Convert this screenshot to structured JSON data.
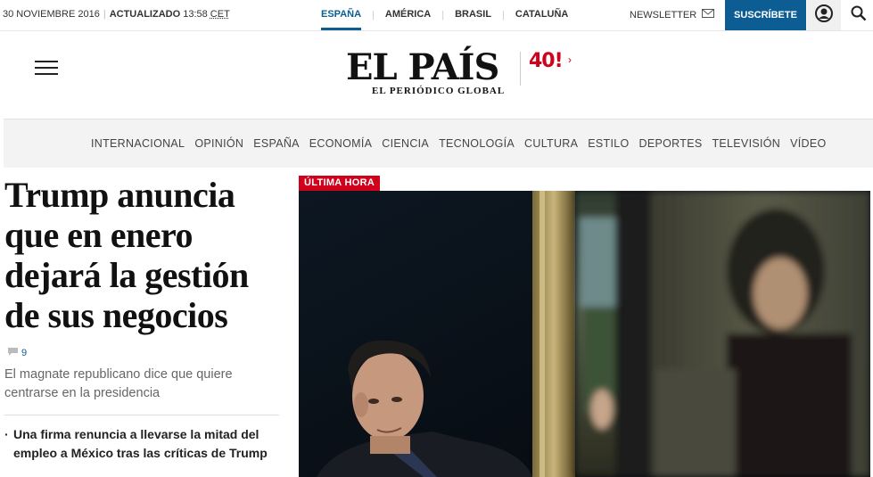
{
  "topbar": {
    "date": "30 NOVIEMBRE 2016",
    "updated_label": "ACTUALIZADO",
    "updated_time": "13:58",
    "timezone": "CET",
    "editions": [
      {
        "label": "ESPAÑA",
        "active": true
      },
      {
        "label": "AMÉRICA",
        "active": false
      },
      {
        "label": "BRASIL",
        "active": false
      },
      {
        "label": "CATALUÑA",
        "active": false
      }
    ],
    "newsletter_label": "NEWSLETTER",
    "subscribe_label": "SUSCRÍBETE"
  },
  "header": {
    "logo_name": "EL PAÍS",
    "logo_tagline": "EL PERIÓDICO GLOBAL",
    "anniversary": "40!"
  },
  "sections": [
    "INTERNACIONAL",
    "OPINIÓN",
    "ESPAÑA",
    "ECONOMÍA",
    "CIENCIA",
    "TECNOLOGÍA",
    "CULTURA",
    "ESTILO",
    "DEPORTES",
    "TELEVISIÓN",
    "VÍDEO"
  ],
  "lead": {
    "headline": "Trump anuncia que en enero dejará la gestión de sus negocios",
    "comment_count": "9",
    "standfirst": "El magnate republicano dice que quiere centrarse en la presidencia",
    "related": "Una firma renuncia a llevarse la mitad del empleo a México tras las críticas de Trump"
  },
  "photo": {
    "badge": "ÚLTIMA HORA"
  },
  "colors": {
    "brand_blue": "#0b5d93",
    "breaking_red": "#d0021b"
  },
  "icons": {
    "newsletter": "envelope-icon",
    "profile": "user-icon",
    "search": "search-icon",
    "menu": "hamburger-icon",
    "comments": "speech-bubble-icon"
  }
}
